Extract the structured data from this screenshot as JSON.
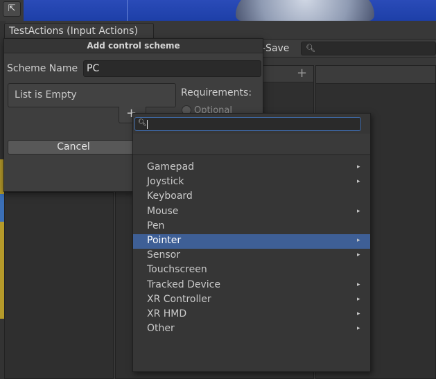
{
  "window": {
    "tab_title": "TestActions (Input Actions)",
    "toolbar_save_label": "-Save"
  },
  "dialog": {
    "title": "Add control scheme",
    "scheme_name_label": "Scheme Name",
    "scheme_name_value": "PC",
    "list_empty_text": "List is Empty",
    "add_plus": "+",
    "requirements_label": "Requirements:",
    "optional_label": "Optional",
    "cancel_label": "Cancel"
  },
  "actions_column": {
    "add_plus": "+"
  },
  "device_dropdown": {
    "search_value": "",
    "items": [
      {
        "label": "Gamepad",
        "has_submenu": true,
        "selected": false
      },
      {
        "label": "Joystick",
        "has_submenu": true,
        "selected": false
      },
      {
        "label": "Keyboard",
        "has_submenu": false,
        "selected": false
      },
      {
        "label": "Mouse",
        "has_submenu": true,
        "selected": false
      },
      {
        "label": "Pen",
        "has_submenu": false,
        "selected": false
      },
      {
        "label": "Pointer",
        "has_submenu": true,
        "selected": true
      },
      {
        "label": "Sensor",
        "has_submenu": true,
        "selected": false
      },
      {
        "label": "Touchscreen",
        "has_submenu": false,
        "selected": false
      },
      {
        "label": "Tracked Device",
        "has_submenu": true,
        "selected": false
      },
      {
        "label": "XR Controller",
        "has_submenu": true,
        "selected": false
      },
      {
        "label": "XR HMD",
        "has_submenu": true,
        "selected": false
      },
      {
        "label": "Other",
        "has_submenu": true,
        "selected": false
      }
    ]
  },
  "icons": {
    "tool_icon": "move-tool-icon",
    "search_icon": "search-icon",
    "submenu_arrow": "chevron-right-icon"
  },
  "colors": {
    "selection": "#3e5f96",
    "focus_border": "#3f6aa8"
  }
}
